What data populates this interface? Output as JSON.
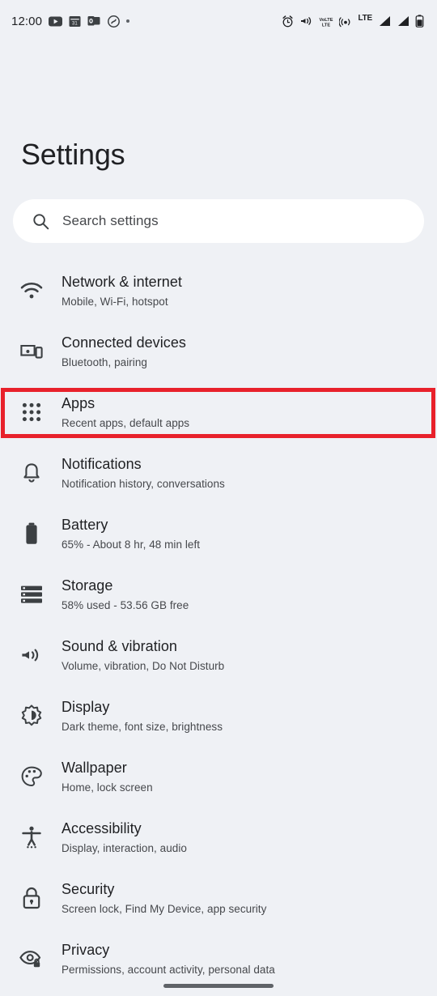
{
  "status_bar": {
    "clock": "12:00",
    "left_icons": [
      {
        "name": "youtube-icon"
      },
      {
        "name": "calendar-notification-icon"
      },
      {
        "name": "outlook-icon"
      },
      {
        "name": "shazam-icon"
      },
      {
        "name": "more-notifications-dot-icon"
      }
    ],
    "right_icons": [
      {
        "name": "alarm-icon"
      },
      {
        "name": "vibrate-icon"
      },
      {
        "name": "volte-icon",
        "label": "VoLTE"
      },
      {
        "name": "hotspot-icon"
      },
      {
        "name": "lte-label-icon",
        "label": "LTE"
      },
      {
        "name": "signal-bars-sim1-icon"
      },
      {
        "name": "signal-bars-sim2-icon"
      },
      {
        "name": "battery-icon"
      }
    ]
  },
  "header": {
    "title": "Settings"
  },
  "search": {
    "icon": "search-icon",
    "placeholder": "Search settings",
    "value": ""
  },
  "settings": {
    "items": [
      {
        "icon": "wifi-icon",
        "title": "Network & internet",
        "subtitle": "Mobile, Wi-Fi, hotspot",
        "highlighted": false
      },
      {
        "icon": "connected-devices-icon",
        "title": "Connected devices",
        "subtitle": "Bluetooth, pairing",
        "highlighted": false
      },
      {
        "icon": "apps-grid-icon",
        "title": "Apps",
        "subtitle": "Recent apps, default apps",
        "highlighted": true
      },
      {
        "icon": "bell-icon",
        "title": "Notifications",
        "subtitle": "Notification history, conversations",
        "highlighted": false
      },
      {
        "icon": "battery-icon",
        "title": "Battery",
        "subtitle": "65% - About 8 hr, 48 min left",
        "highlighted": false
      },
      {
        "icon": "storage-icon",
        "title": "Storage",
        "subtitle": "58% used - 53.56 GB free",
        "highlighted": false
      },
      {
        "icon": "sound-icon",
        "title": "Sound & vibration",
        "subtitle": "Volume, vibration, Do Not Disturb",
        "highlighted": false
      },
      {
        "icon": "display-brightness-icon",
        "title": "Display",
        "subtitle": "Dark theme, font size, brightness",
        "highlighted": false
      },
      {
        "icon": "wallpaper-palette-icon",
        "title": "Wallpaper",
        "subtitle": "Home, lock screen",
        "highlighted": false
      },
      {
        "icon": "accessibility-icon",
        "title": "Accessibility",
        "subtitle": "Display, interaction, audio",
        "highlighted": false
      },
      {
        "icon": "lock-icon",
        "title": "Security",
        "subtitle": "Screen lock, Find My Device, app security",
        "highlighted": false
      },
      {
        "icon": "privacy-eye-icon",
        "title": "Privacy",
        "subtitle": "Permissions, account activity, personal data",
        "highlighted": false
      }
    ]
  },
  "annotation": {
    "highlight_color": "#e8212b",
    "target": "Apps"
  },
  "colors": {
    "background": "#eff1f5",
    "search_background": "#ffffff",
    "primary_text": "#1f2023",
    "secondary_text": "#46484c",
    "icon": "#3c4043"
  },
  "nav_bar": {
    "handle": "gesture-nav-handle"
  }
}
